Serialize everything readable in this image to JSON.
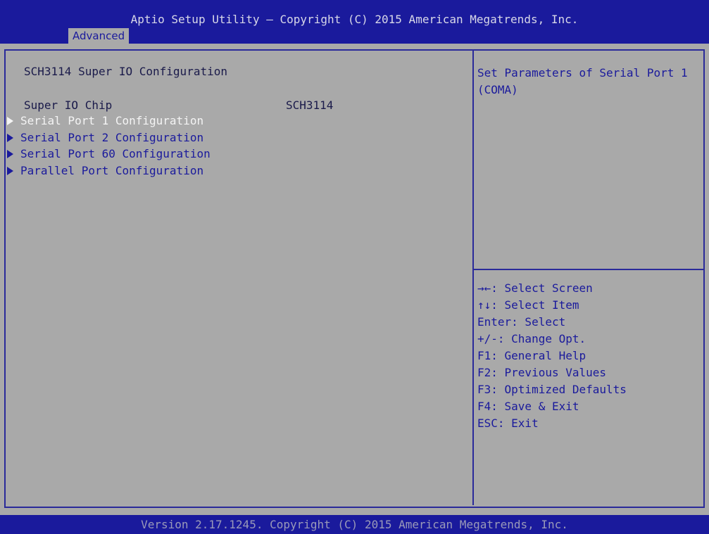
{
  "header": {
    "title": "Aptio Setup Utility – Copyright (C) 2015 American Megatrends, Inc.",
    "active_tab": "Advanced"
  },
  "main": {
    "section_title": "SCH3114 Super IO Configuration",
    "chip_label": "Super IO Chip",
    "chip_value": "SCH3114",
    "menu_items": [
      {
        "label": "Serial Port 1 Configuration",
        "selected": true
      },
      {
        "label": "Serial Port 2 Configuration",
        "selected": false
      },
      {
        "label": "Serial Port 60 Configuration",
        "selected": false
      },
      {
        "label": "Parallel Port Configuration",
        "selected": false
      }
    ]
  },
  "help": {
    "text": "Set Parameters of Serial Port 1 (COMA)",
    "keys": [
      "→←: Select Screen",
      "↑↓: Select Item",
      "Enter: Select",
      "+/-: Change Opt.",
      "F1: General Help",
      "F2: Previous Values",
      "F3: Optimized Defaults",
      "F4: Save & Exit",
      "ESC: Exit"
    ]
  },
  "footer": {
    "text": "Version 2.17.1245. Copyright (C) 2015 American Megatrends, Inc."
  },
  "colors": {
    "title_bar": "#1a1a9c",
    "background": "#a9a9a9",
    "selected_text": "#f4f4f4",
    "item_text": "#1a1a9c"
  }
}
